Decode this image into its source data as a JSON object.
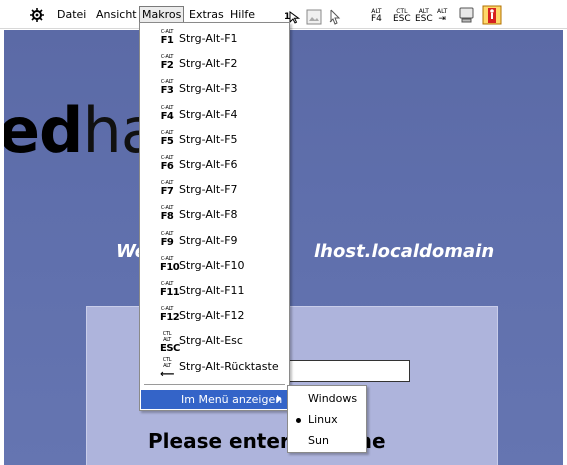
{
  "toolbar": {
    "icons": [
      {
        "name": "settings-icon"
      },
      {
        "name": "mouse-pointer-icon"
      },
      {
        "name": "image-icon"
      },
      {
        "name": "cursor-icon"
      },
      {
        "name": "alt-f4-icon",
        "top": "ALT",
        "bottom": "F4"
      },
      {
        "name": "ctl-esc-icon",
        "top": "CTL",
        "bottom": "ESC"
      },
      {
        "name": "alt-esc-icon",
        "top": "ALT",
        "bottom": "ESC"
      },
      {
        "name": "alt-tab-icon",
        "top": "ALT",
        "bottom": "⇥"
      },
      {
        "name": "screen-icon"
      },
      {
        "name": "exit-icon"
      }
    ],
    "menu": [
      "Datei",
      "Ansicht",
      "Makros",
      "Extras",
      "Hilfe"
    ]
  },
  "desktop": {
    "logo_bold": "ed",
    "logo_light": "ha",
    "welcome_left": "We",
    "welcome_right": "lhost.localdomain",
    "prompt_left": "Please enter y",
    "prompt_right": "ername"
  },
  "makros_menu": {
    "items": [
      {
        "icon_top": "C-ALT",
        "icon_bottom": "F1",
        "label": "Strg-Alt-F1"
      },
      {
        "icon_top": "C-ALT",
        "icon_bottom": "F2",
        "label": "Strg-Alt-F2"
      },
      {
        "icon_top": "C-ALT",
        "icon_bottom": "F3",
        "label": "Strg-Alt-F3"
      },
      {
        "icon_top": "C-ALT",
        "icon_bottom": "F4",
        "label": "Strg-Alt-F4"
      },
      {
        "icon_top": "C-ALT",
        "icon_bottom": "F5",
        "label": "Strg-Alt-F5"
      },
      {
        "icon_top": "C-ALT",
        "icon_bottom": "F6",
        "label": "Strg-Alt-F6"
      },
      {
        "icon_top": "C-ALT",
        "icon_bottom": "F7",
        "label": "Strg-Alt-F7"
      },
      {
        "icon_top": "C-ALT",
        "icon_bottom": "F8",
        "label": "Strg-Alt-F8"
      },
      {
        "icon_top": "C-ALT",
        "icon_bottom": "F9",
        "label": "Strg-Alt-F9"
      },
      {
        "icon_top": "C-ALT",
        "icon_bottom": "F10",
        "label": "Strg-Alt-F10"
      },
      {
        "icon_top": "C-ALT",
        "icon_bottom": "F11",
        "label": "Strg-Alt-F11"
      },
      {
        "icon_top": "C-ALT",
        "icon_bottom": "F12",
        "label": "Strg-Alt-F12"
      },
      {
        "icon_top": "CTL ALT",
        "icon_bottom": "ESC",
        "label": "Strg-Alt-Esc"
      },
      {
        "icon_top": "CTL ALT",
        "icon_bottom": "⟵",
        "label": "Strg-Alt-Rücktaste"
      }
    ],
    "show_in_menu": "Im Menü anzeigen"
  },
  "submenu": {
    "items": [
      {
        "label": "Windows",
        "selected": false
      },
      {
        "label": "Linux",
        "selected": true
      },
      {
        "label": "Sun",
        "selected": false
      }
    ]
  },
  "colors": {
    "desktop_bg": "#5f6fac",
    "login_box": "#aeb4dc",
    "menu_highlight": "#3464c8"
  }
}
